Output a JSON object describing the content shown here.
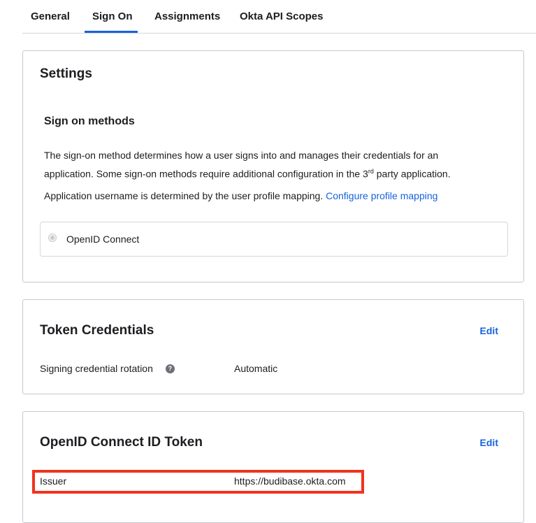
{
  "tabs": [
    {
      "label": "General"
    },
    {
      "label": "Sign On"
    },
    {
      "label": "Assignments"
    },
    {
      "label": "Okta API Scopes"
    }
  ],
  "settings": {
    "title": "Settings",
    "section_title": "Sign on methods",
    "desc_line1": "The sign-on method determines how a user signs into and manages their credentials for an",
    "desc_line2_pre": "application. Some sign-on methods require additional configuration in the 3",
    "desc_sup": "rd",
    "desc_line2_post": " party application.",
    "username_text": "Application username is determined by the user profile mapping.",
    "profile_link": "Configure profile mapping",
    "radio_label": "OpenID Connect"
  },
  "token_credentials": {
    "title": "Token Credentials",
    "edit_label": "Edit",
    "rotation_label": "Signing credential rotation",
    "help_icon": "?",
    "rotation_value": "Automatic"
  },
  "id_token": {
    "title": "OpenID Connect ID Token",
    "edit_label": "Edit",
    "issuer_label": "Issuer",
    "issuer_value": "https://budibase.okta.com"
  },
  "colors": {
    "accent": "#1662dd",
    "highlight": "#f0331f"
  }
}
